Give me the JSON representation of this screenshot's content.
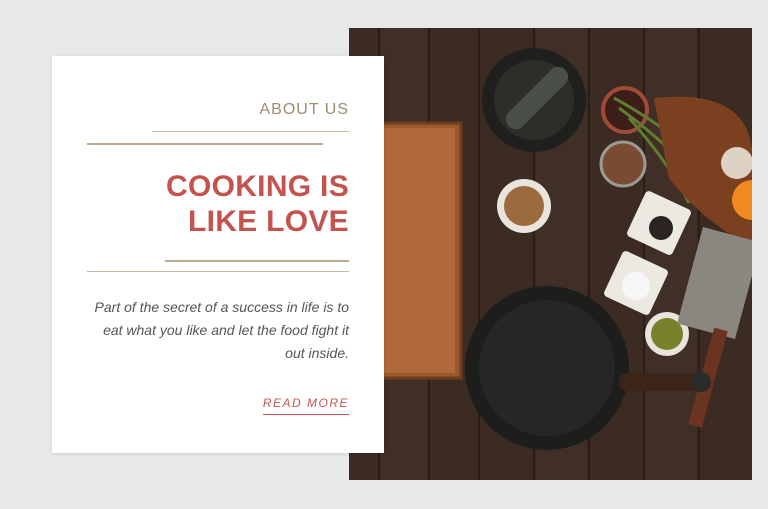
{
  "card": {
    "eyebrow": "ABOUT US",
    "title_line1": "COOKING IS",
    "title_line2": "LIKE LOVE",
    "body": "Part of the secret of a success in life is to eat what you like and let the food fight it out inside.",
    "cta": "READ MORE"
  },
  "colors": {
    "accent": "#c5534d",
    "eyebrow": "#a08a70",
    "rule": "#bba98f",
    "background": "#e8e8e8"
  }
}
